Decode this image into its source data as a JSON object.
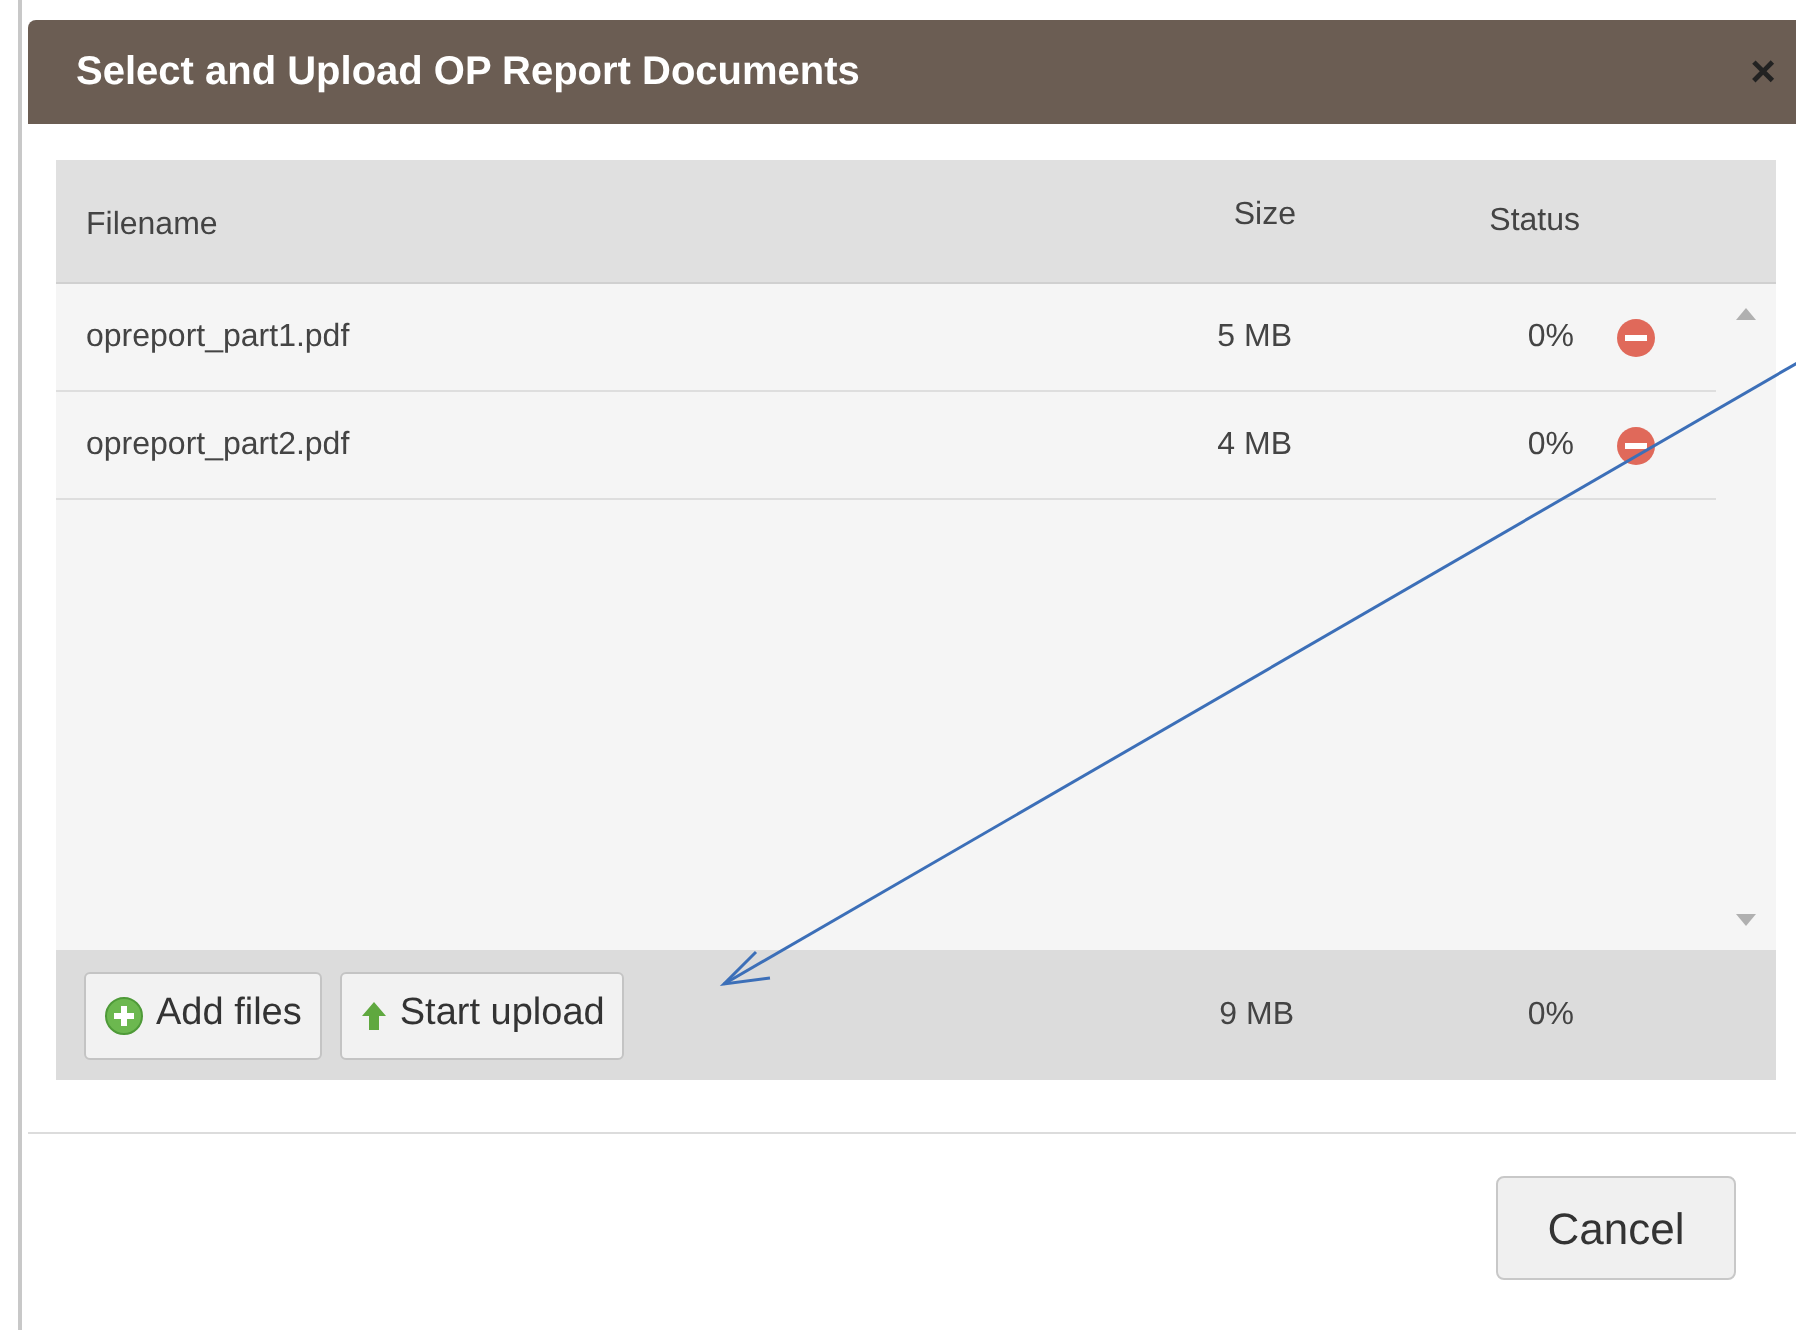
{
  "dialog": {
    "title": "Select and Upload OP Report Documents",
    "close": "×"
  },
  "table": {
    "columns": [
      "Filename",
      "Size",
      "Status"
    ],
    "rows": [
      {
        "filename": "opreport_part1.pdf",
        "size": "5 MB",
        "status": "0%"
      },
      {
        "filename": "opreport_part2.pdf",
        "size": "4 MB",
        "status": "0%"
      }
    ]
  },
  "footer": {
    "buttons": [
      {
        "label": "Add files",
        "kind": "add"
      },
      {
        "label": "Start upload",
        "kind": "upload"
      }
    ],
    "total_size": "9 MB",
    "total_status": "0%"
  },
  "actions": [
    "Cancel"
  ]
}
